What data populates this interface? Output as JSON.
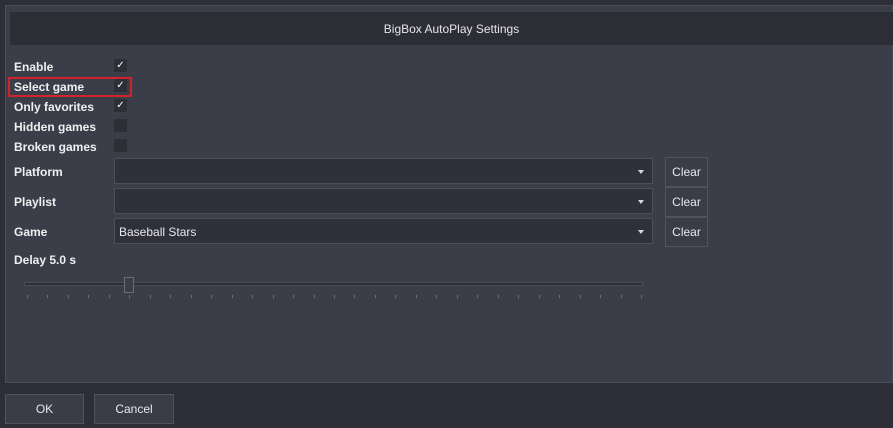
{
  "window": {
    "title": "BigBox AutoPlay Settings"
  },
  "options": [
    {
      "label": "Enable",
      "checked": true
    },
    {
      "label": "Select game",
      "checked": true
    },
    {
      "label": "Only favorites",
      "checked": true
    },
    {
      "label": "Hidden games",
      "checked": false
    },
    {
      "label": "Broken games",
      "checked": false
    }
  ],
  "filters": [
    {
      "label": "Platform",
      "value": "",
      "clear_label": "Clear"
    },
    {
      "label": "Playlist",
      "value": "",
      "clear_label": "Clear"
    },
    {
      "label": "Game",
      "value": "Baseball Stars",
      "clear_label": "Clear"
    }
  ],
  "delay": {
    "label": "Delay 5.0 s",
    "value_fraction": 0.17
  },
  "footer": {
    "ok_label": "OK",
    "cancel_label": "Cancel"
  },
  "colors": {
    "highlight": "#d0232a",
    "background": "#3b3d48"
  }
}
